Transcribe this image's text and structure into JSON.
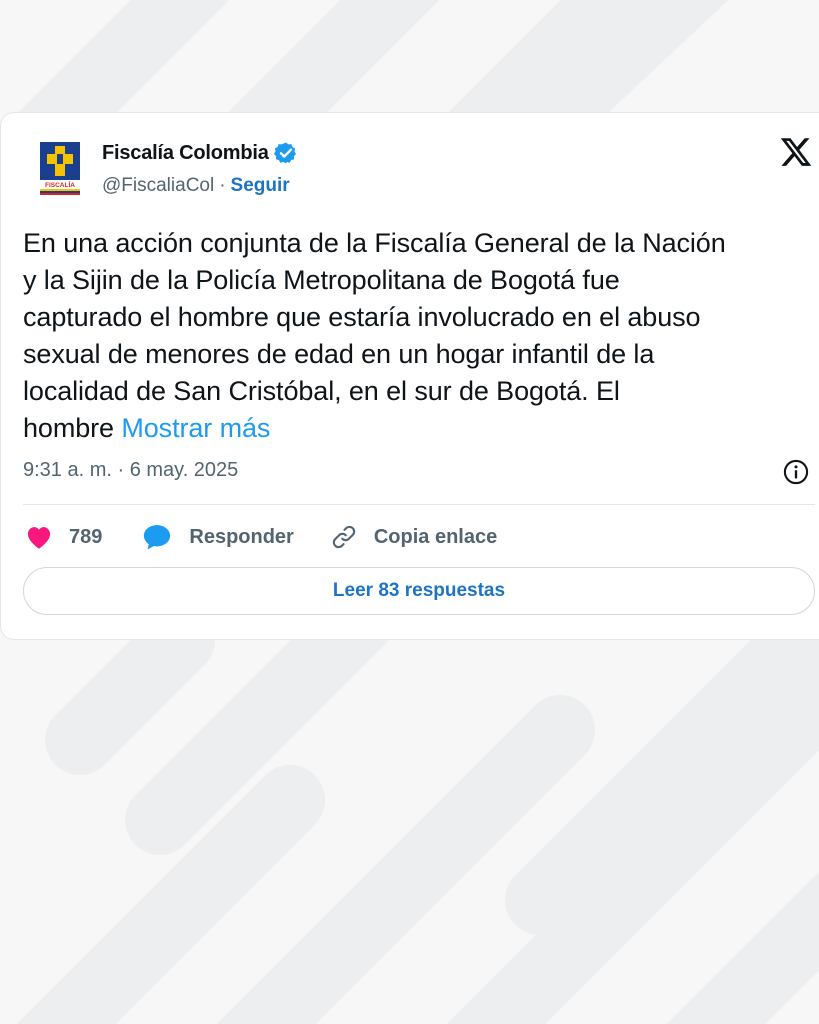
{
  "tweet": {
    "author": {
      "display_name": "Fiscalía Colombia",
      "handle": "@FiscaliaCol",
      "separator": "·",
      "follow_label": "Seguir",
      "verified": true,
      "avatar_text": "FISCALÍA"
    },
    "body_lines": [
      "En una acción conjunta de la Fiscalía General de la Nación",
      "y la Sijin de la Policía Metropolitana de Bogotá fue",
      "capturado el hombre que estaría involucrado en el abuso",
      "sexual de menores de edad en un hogar infantil de la",
      "localidad de San Cristóbal, en el sur de Bogotá. El"
    ],
    "body_last_line": "hombre",
    "show_more_label": "Mostrar más",
    "timestamp": "9:31 a. m. · 6 may. 2025",
    "actions": {
      "like_count": "789",
      "reply_label": "Responder",
      "copy_link_label": "Copia enlace"
    },
    "read_replies_label": "Leer 83 respuestas"
  },
  "icons": {
    "platform": "x-logo-icon",
    "verified": "verified-badge-icon",
    "info": "info-icon",
    "like": "heart-icon",
    "reply": "speech-bubble-icon",
    "copy": "link-icon"
  },
  "colors": {
    "accent": "#1d9bf0",
    "link_bold": "#1d74c4",
    "like": "#f91880",
    "muted_text": "#536471",
    "text": "#0f1419"
  }
}
